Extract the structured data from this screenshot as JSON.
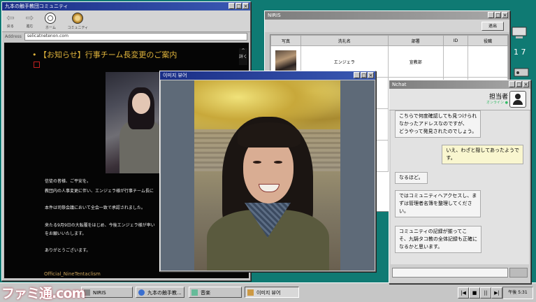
{
  "desktop": {
    "clock_fragment": "1 7"
  },
  "browser": {
    "title": "九本の触手教団コミュニティ",
    "toolbar": {
      "back": "戻る",
      "forward": "進む",
      "emblem1": "ホーム",
      "emblem2": "コミュニティ"
    },
    "address_label": "Address",
    "address_value": "selicatnetenon.com",
    "notice_title": "• 【お知らせ】行事チーム長変更のご案内",
    "scroll_label": "詳く",
    "body_lines": [
      "信徒の皆様、ご平安を。",
      "教団内の人事変更に伴い、エンジェラ様が行事チーム長に",
      "本件は司祭会議において全会一致で承認されました。",
      "来たる9月9日の大転覆をはじめ、今後エンジェラ様が率い",
      "をお願いいたします。",
      "ありがとうございます。"
    ],
    "footer": "Official_NineTentaclism"
  },
  "niris": {
    "title": "NIRIS",
    "logout": "退出",
    "columns": [
      "写真",
      "洗礼名",
      "部署",
      "ID",
      "役職"
    ],
    "rows": [
      {
        "name": "エンジェラ",
        "dept": "宣教部",
        "id": "",
        "role": ""
      }
    ]
  },
  "viewer": {
    "title": "이미지 뷰어"
  },
  "chat": {
    "title": "Nchat",
    "contact": "担当者",
    "status": "オンライン ●",
    "messages": [
      {
        "from": "them",
        "lines": [
          "こちらで何度確認しても見つけられ",
          "なかったアドレスなのですが、",
          "どうやって発見されたのでしょう。"
        ]
      },
      {
        "from": "me",
        "lines": [
          "いえ、わざと隠してあったようで",
          "す。"
        ]
      },
      {
        "from": "them",
        "lines": [
          "なるほど。"
        ]
      },
      {
        "from": "them",
        "lines": [
          "ではコミュニティへアクセスし、ま",
          "ずは管理者名簿を整理してくださ",
          "い。"
        ]
      },
      {
        "from": "them",
        "lines": [
          "コミュニティの記録が揃ってこ",
          "そ、九騎タコ教の全体記録も正確に",
          "なるかと思います。"
        ]
      }
    ]
  },
  "taskbar": {
    "items": [
      "NIRIS",
      "九本の触手教...",
      "音楽",
      "이미지 뷰어"
    ],
    "clock": "午後 5:31"
  },
  "watermark": "ファミ通.com"
}
